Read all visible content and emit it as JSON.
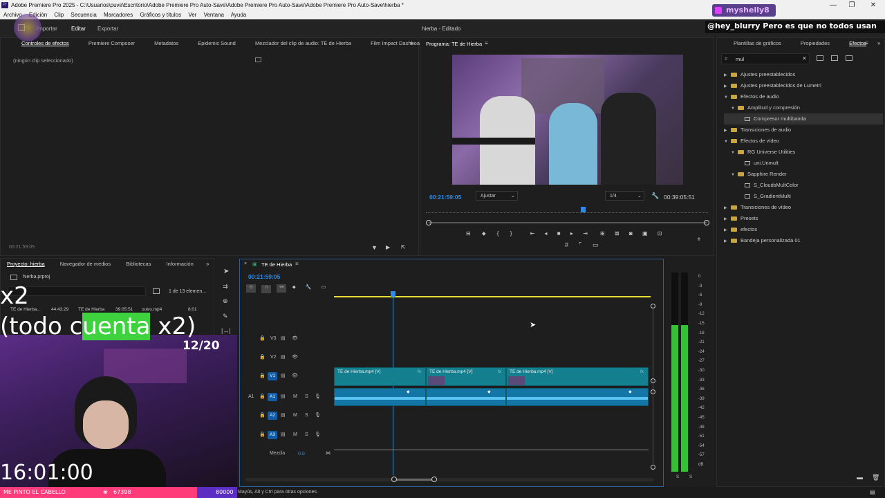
{
  "window": {
    "title": "Adobe Premiere Pro 2025 - C:\\Usuarios\\puve\\Escritorio\\Adobe Premiere Pro Auto-Save\\Adobe Premiere Pro Auto-Save\\Adobe Premiere Pro Auto-Save\\hierba *",
    "min": "—",
    "max": "❐",
    "close": "✕"
  },
  "menu": [
    "Archivo",
    "Edición",
    "Clip",
    "Secuencia",
    "Marcadores",
    "Gráficos y títulos",
    "Ver",
    "Ventana",
    "Ayuda"
  ],
  "appbar": {
    "import": "Importar",
    "edit": "Editar",
    "export": "Exportar",
    "project_status": "hierba - Editado"
  },
  "chat": {
    "user": "myshelly8",
    "message": "@hey_blurry Pero es que no todos usan"
  },
  "effect_controls": {
    "tabs": [
      "Controles de efectos",
      "Premiere Composer",
      "Metadatos",
      "Epidemic Sound",
      "Mezclador del clip de audio: TE de Hierba",
      "Film Impact Dashboa"
    ],
    "no_clip": "(ningún clip seleccionado)",
    "timecode": "00:21:59:05"
  },
  "program": {
    "title": "Programa: TE de Hierba",
    "timecode": "00:21:59:05",
    "fit": "Ajustar",
    "quality": "1/4",
    "duration": "00:39:05:51"
  },
  "project": {
    "tabs": [
      "Proyecto: hierba",
      "Navegador de medios",
      "Bibliotecas",
      "Información"
    ],
    "file": "hierba.prproj",
    "count": "1 de 13 elemen...",
    "items": [
      {
        "name": "TE de Hierba...",
        "dur": "44:43:29"
      },
      {
        "name": "TE de Hierba",
        "dur": "39:05:51"
      },
      {
        "name": "outro.mp4",
        "dur": "8:01"
      }
    ]
  },
  "timeline": {
    "tab": "TE de Hierba",
    "timecode": "00:21:59:05",
    "video_tracks": [
      "V3",
      "V2",
      "V1"
    ],
    "audio_tracks": [
      "A1",
      "A2",
      "A3"
    ],
    "source_patch_v": "V1",
    "source_patch_a": "A1",
    "mix_label": "Mezcla",
    "mix_value": "0.0",
    "clips": [
      "TE de Hierba.mp4 [V]",
      "TE de Hierba.mp4 [V]",
      "TE de Hierba.mp4 [V]"
    ],
    "m": "M",
    "s": "S",
    "fx": "fx"
  },
  "meter": {
    "scale": [
      "0",
      "-3",
      "-6",
      "-9",
      "-12",
      "-15",
      "-18",
      "-21",
      "-24",
      "-27",
      "-30",
      "-33",
      "-36",
      "-39",
      "-42",
      "-45",
      "-48",
      "-51",
      "-54",
      "-57",
      "dB"
    ],
    "s_left": "S",
    "s_right": "S"
  },
  "effects_panel": {
    "tabs": [
      "Plantillas de gráficos",
      "Propiedades",
      "Efectos"
    ],
    "search_value": "mul",
    "tree": [
      {
        "label": "Ajustes preestablecidos",
        "indent": 0,
        "kind": "folder",
        "open": false
      },
      {
        "label": "Ajustes preestablecidos de Lumetri",
        "indent": 0,
        "kind": "folder",
        "open": false
      },
      {
        "label": "Efectos de audio",
        "indent": 0,
        "kind": "folder",
        "open": true
      },
      {
        "label": "Amplitud y compresión",
        "indent": 1,
        "kind": "folder",
        "open": true
      },
      {
        "label": "Compresor multibanda",
        "indent": 2,
        "kind": "fx",
        "selected": true
      },
      {
        "label": "Transiciones de audio",
        "indent": 0,
        "kind": "folder",
        "open": false
      },
      {
        "label": "Efectos de vídeo",
        "indent": 0,
        "kind": "folder",
        "open": true
      },
      {
        "label": "RG Universe Utilities",
        "indent": 1,
        "kind": "folder",
        "open": true
      },
      {
        "label": "uni.Unmult",
        "indent": 2,
        "kind": "fx"
      },
      {
        "label": "Sapphire Render",
        "indent": 1,
        "kind": "folder",
        "open": true
      },
      {
        "label": "S_CloudsMultColor",
        "indent": 2,
        "kind": "fx"
      },
      {
        "label": "S_GradientMulti",
        "indent": 2,
        "kind": "fx"
      },
      {
        "label": "Transiciones de vídeo",
        "indent": 0,
        "kind": "folder",
        "open": false
      },
      {
        "label": "Presets",
        "indent": 0,
        "kind": "folder",
        "open": false
      },
      {
        "label": "efectos",
        "indent": 0,
        "kind": "folder",
        "open": false
      },
      {
        "label": "Bandeja personalizada 01",
        "indent": 0,
        "kind": "folder",
        "open": false
      }
    ]
  },
  "status_bar": {
    "hint": "Mayús, Alt y Ctrl para otras opciones."
  },
  "stream_overlay": {
    "x2": "x2",
    "todo_pre": "(todo c",
    "todo_hl": "uenta",
    "todo_post": " x2)",
    "counter": "12/20",
    "clock": "16:01:00",
    "ticker": "ME PINTO EL CABELLO",
    "coins": "67398",
    "goal": "80000"
  },
  "colors": {
    "accent": "#2d8ceb",
    "clip_video": "#147f8f",
    "clip_audio": "#1476a6",
    "meter_green": "#33c233",
    "track_btn": "#0f5da8"
  }
}
